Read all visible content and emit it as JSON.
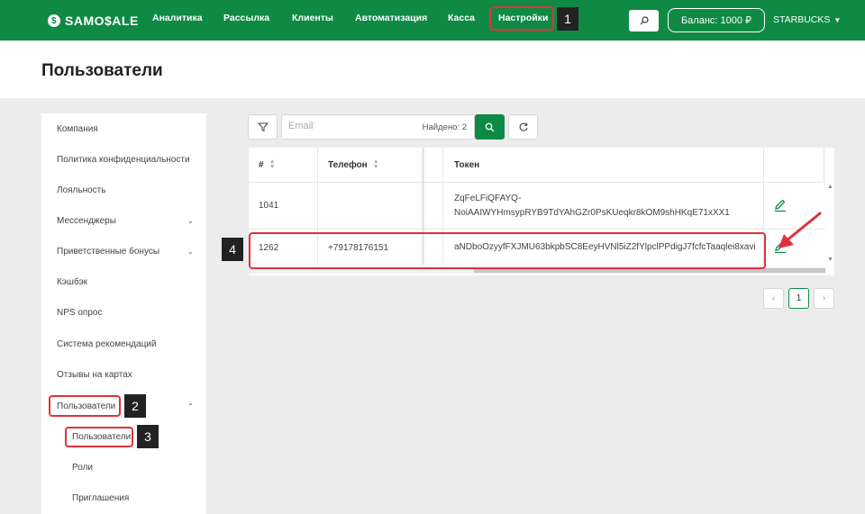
{
  "topbar": {
    "logo": "SAMO$ALE",
    "nav": [
      "Аналитика",
      "Рассылка",
      "Клиенты",
      "Автоматизация",
      "Касса",
      "Настройки"
    ],
    "balance": "Баланс: 1000 ₽",
    "account": "STARBUCKS"
  },
  "page": {
    "title": "Пользователи"
  },
  "sidebar": {
    "items": [
      "Компания",
      "Политика конфиденциальности",
      "Лояльность",
      "Мессенджеры",
      "Приветственные бонусы",
      "Кэшбэк",
      "NPS опрос",
      "Система рекомендаций",
      "Отзывы на картах",
      "Пользователи"
    ],
    "subitems": [
      "Пользователи",
      "Роли",
      "Приглашения"
    ]
  },
  "filter": {
    "email_placeholder": "Email",
    "found": "Найдено: 2"
  },
  "table": {
    "headers": [
      "#",
      "Телефон",
      "Токен"
    ],
    "rows": [
      {
        "id": "1041",
        "phone": "",
        "token_line1": "ZqFeLFiQFAYQ-",
        "token_line2": "NoiAAIWYHmsypRYB9TdYAhGZr0PsKUeqkr8kOM9shHKqE71xXX1"
      },
      {
        "id": "1262",
        "phone": "+79178176151",
        "token_line1": "aNDboOzyyfFXJMU63bkpbSC8EeyHVNl5iZ2fYlpclPPdigJ7fcfcTaaqlei8xavi",
        "token_line2": ""
      }
    ]
  },
  "pagination": {
    "prev": "‹",
    "page": "1",
    "next": "›"
  },
  "annotations": [
    "1",
    "2",
    "3",
    "4"
  ],
  "colors": {
    "brand": "#0e8a45",
    "annotation": "#e0323a"
  }
}
